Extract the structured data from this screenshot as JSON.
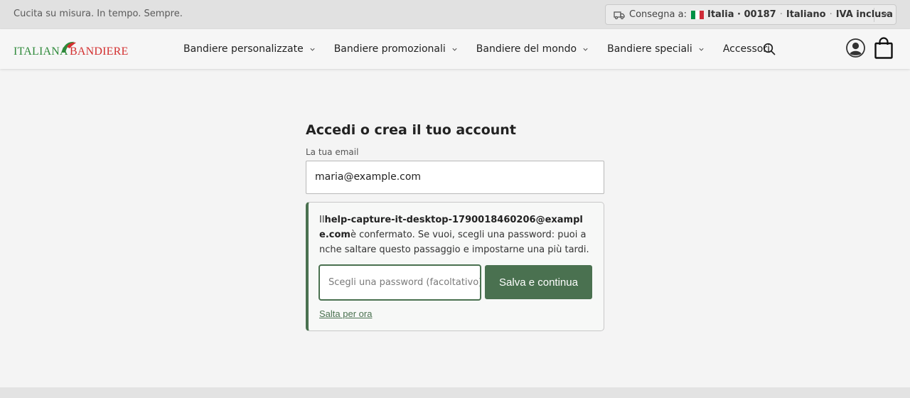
{
  "topbar": {
    "tagline": "Cucita su misura. In tempo. Sempre.",
    "shipping": {
      "label": "Consegna a:",
      "country": "Italia · 00187",
      "separator": "·",
      "language": "Italiano",
      "vat": "IVA inclusa",
      "flag_colors": [
        "#009246",
        "#ffffff",
        "#ce2b37"
      ]
    }
  },
  "header": {
    "logo": {
      "part1": "ITALIANA",
      "part2": "BANDIERE"
    },
    "nav": [
      {
        "label": "Bandiere personalizzate",
        "has_dropdown": true
      },
      {
        "label": "Bandiere promozionali",
        "has_dropdown": true
      },
      {
        "label": "Bandiere del mondo",
        "has_dropdown": true
      },
      {
        "label": "Bandiere speciali",
        "has_dropdown": true
      },
      {
        "label": "Accessori",
        "has_dropdown": false
      }
    ],
    "icons": [
      "search-icon",
      "account-icon",
      "cart-icon"
    ]
  },
  "login": {
    "title": "Accedi o crea il tuo account",
    "email_label": "La tua email",
    "email_value": "maria@example.com",
    "confirm": {
      "prefix": "Il",
      "email": "help-capture-it-desktop-1790018460206@example.com",
      "suffix": "è confermato. Se vuoi, scegli una password: puoi anche saltare questo passaggio e impostarne una più tardi."
    },
    "password_placeholder": "Scegli una password (facoltativo)",
    "save_label": "Salva e continua",
    "skip_label": "Salta per ora"
  },
  "colors": {
    "accent": "#4a7150",
    "topbar_bg": "#e1e1e1",
    "page_bg": "#f4f4f4"
  }
}
